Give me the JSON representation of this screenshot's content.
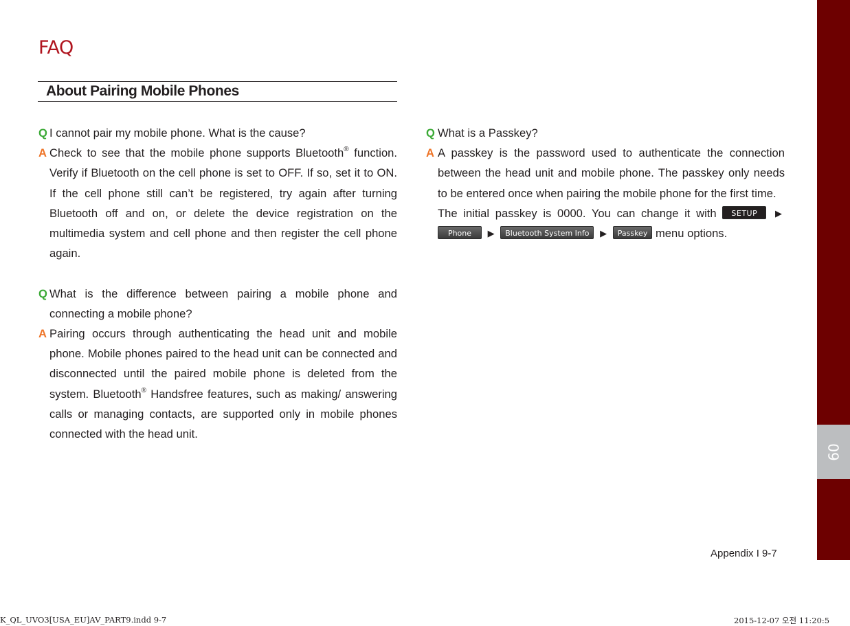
{
  "page": {
    "title": "FAQ",
    "section_heading": "About Pairing Mobile Phones",
    "chapter_tab": "09",
    "footer": "Appendix I 9-7",
    "slug_left": "K_QL_UVO3[USA_EU]AV_PART9.indd   9-7",
    "slug_right": "2015-12-07   오전 11:20:5"
  },
  "markers": {
    "q": "Q",
    "a": "A"
  },
  "colors": {
    "title_red": "#b0151f",
    "q_green": "#3aa935",
    "a_orange": "#ee7427",
    "sidebar_red": "#6d0000",
    "sidebar_gray": "#bcbec0"
  },
  "faq": [
    {
      "question": "I cannot pair my mobile phone. What is the cause?",
      "answer_pre": "Check to see that the mobile phone supports Bluetooth",
      "answer_sup": "®",
      "answer_post": " function. Verify if Bluetooth on the cell phone is set to OFF. If so, set it to ON. If the cell phone still can’t be registered, try again after turning Bluetooth off and on, or delete the device registration on the multimedia system and cell phone and then register the cell phone again."
    },
    {
      "question": "What is the difference between pairing a mobile phone and connecting a mobile phone?",
      "answer_pre": "Pairing occurs through authenticating the head unit and mobile phone. Mobile phones paired to the head unit can be connected and disconnected until the paired mobile phone is deleted from the system. Bluetooth",
      "answer_sup": "®",
      "answer_post": " Handsfree features, such as making/ answering calls or managing contacts, are supported only in mobile phones connected with the head unit."
    },
    {
      "question": "What is a Passkey?",
      "answer": "A passkey is the password used to authenticate the connection between the head unit and mobile phone. The passkey only needs to be entered once when pairing the mobile phone for the first time.",
      "answer_extra_pre": "The initial passkey is 0000. You can change it with",
      "menu_path": [
        "SETUP",
        "Phone",
        "Bluetooth System Info",
        "Passkey"
      ],
      "arrow": "▶",
      "answer_extra_post": "menu options."
    }
  ]
}
